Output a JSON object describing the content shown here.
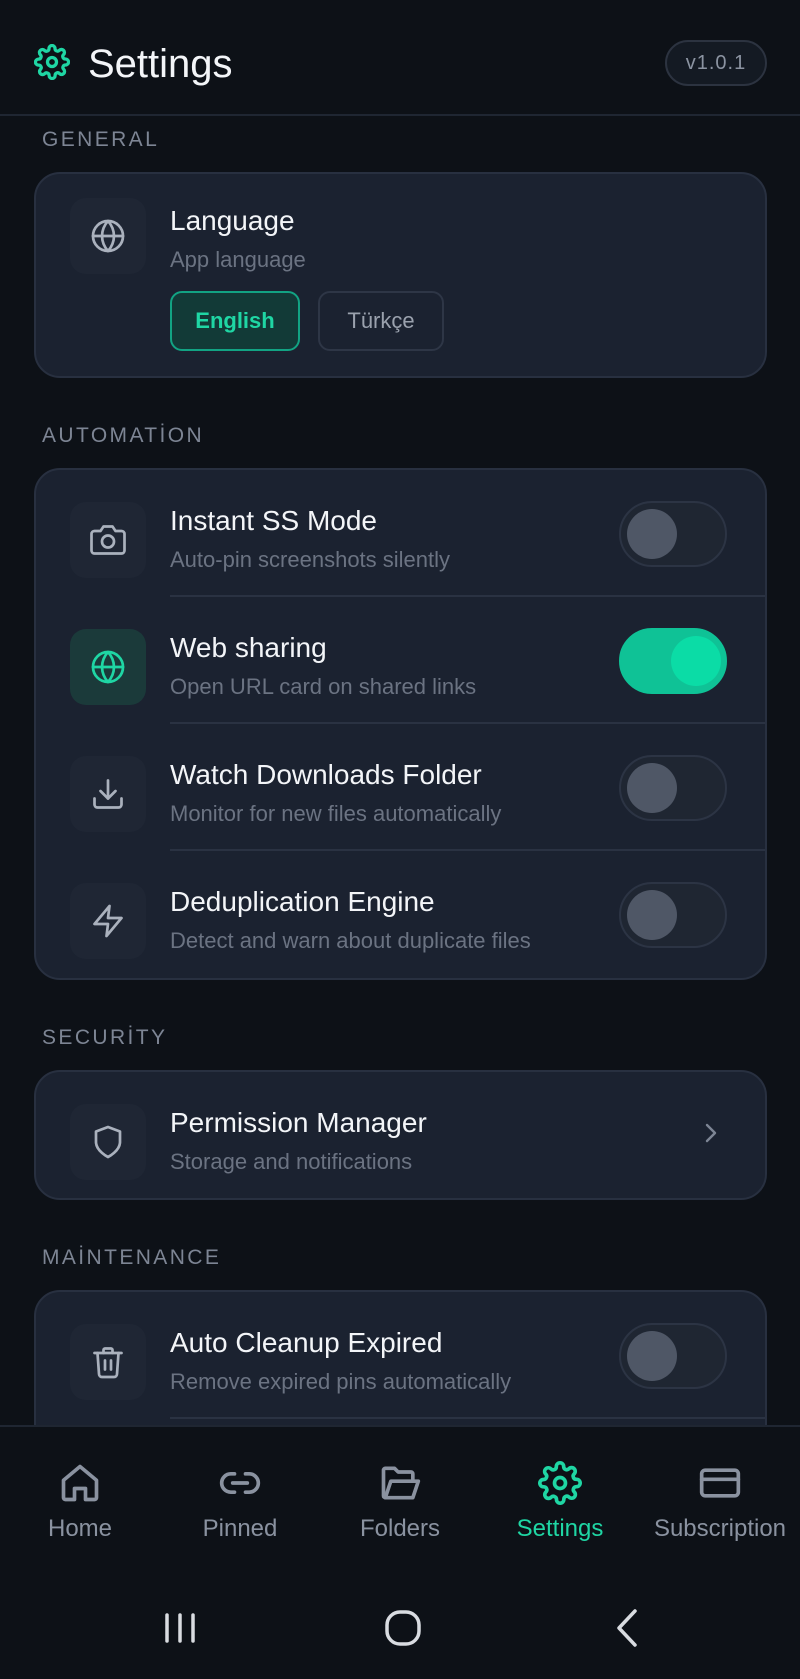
{
  "header": {
    "title": "Settings",
    "version": "v1.0.1",
    "icon": "gear-icon"
  },
  "sections": {
    "general": {
      "label": "GENERAL",
      "language": {
        "title": "Language",
        "subtitle": "App language",
        "icon": "globe-icon",
        "options": [
          "English",
          "Türkçe"
        ],
        "selected": "English"
      }
    },
    "automation": {
      "label": "AUTOMATİON",
      "items": [
        {
          "title": "Instant SS Mode",
          "subtitle": "Auto-pin screenshots silently",
          "icon": "camera-icon",
          "enabled": false
        },
        {
          "title": "Web sharing",
          "subtitle": "Open URL card on shared links",
          "icon": "globe-icon",
          "enabled": true
        },
        {
          "title": "Watch Downloads Folder",
          "subtitle": "Monitor for new files automatically",
          "icon": "download-icon",
          "enabled": false
        },
        {
          "title": "Deduplication Engine",
          "subtitle": "Detect and warn about duplicate files",
          "icon": "lightning-icon",
          "enabled": false
        }
      ]
    },
    "security": {
      "label": "SECURİTY",
      "items": [
        {
          "title": "Permission Manager",
          "subtitle": "Storage and notifications",
          "icon": "shield-icon"
        }
      ]
    },
    "maintenance": {
      "label": "MAİNTENANCE",
      "items": [
        {
          "title": "Auto Cleanup Expired",
          "subtitle": "Remove expired pins automatically",
          "icon": "trash-icon",
          "enabled": false
        }
      ]
    }
  },
  "bottom_nav": {
    "items": [
      {
        "label": "Home",
        "icon": "home-icon"
      },
      {
        "label": "Pinned",
        "icon": "link-icon"
      },
      {
        "label": "Folders",
        "icon": "folder-open-icon"
      },
      {
        "label": "Settings",
        "icon": "gear-icon"
      },
      {
        "label": "Subscription",
        "icon": "credit-card-icon"
      }
    ],
    "active": "Settings"
  },
  "colors": {
    "accent": "#1fd6a4",
    "background": "#0d1117",
    "card": "#1b2230"
  }
}
